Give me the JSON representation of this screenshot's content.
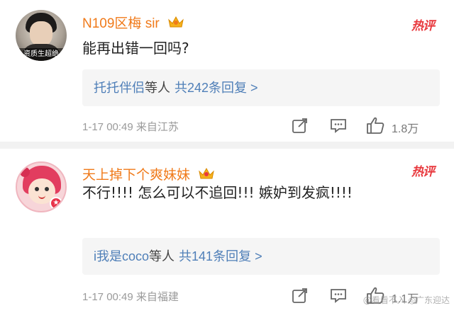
{
  "comments": [
    {
      "username": "N109区梅 sir",
      "avatar_tag": "资质生超绝",
      "hot_label": "热评",
      "text": "能再出错一回吗?",
      "replies": {
        "who": "托托伴侣",
        "etc": "等人",
        "count_text": "共242条回复 >"
      },
      "meta": "1-17 00:49  来自江苏",
      "likes": "1.8万"
    },
    {
      "username": "天上掉下个爽妹妹",
      "avatar_badge": "★",
      "hot_label": "热评",
      "text": "不行!!!! 怎么可以不追回!!! 嫉妒到发疯!!!!",
      "replies": {
        "who": "i我是coco",
        "etc": "等人",
        "count_text": "共141条回复 >"
      },
      "meta": "1-17 00:49  来自福建",
      "likes": "1.1万"
    }
  ],
  "watermark": "@看看不入 ◎广东迎达",
  "colors": {
    "username": "#f07a1a",
    "hot": "#e8383d",
    "link": "#4f7fb8",
    "meta": "#9a9a9a"
  },
  "icons": [
    "crown-icon",
    "share-icon",
    "comment-icon",
    "like-icon"
  ]
}
